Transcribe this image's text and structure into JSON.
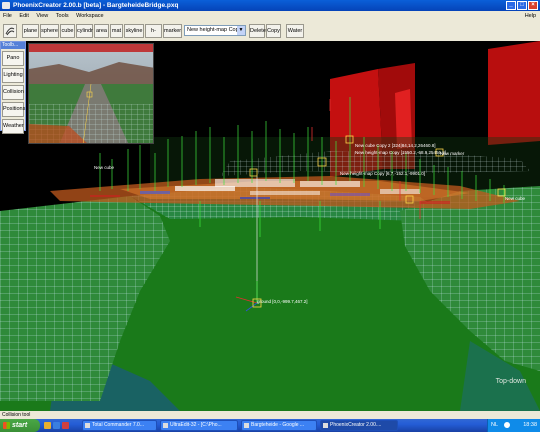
{
  "window": {
    "title": "PhoenixCreator 2.00.b [beta] - BargteheideBridge.pxq",
    "buttons": [
      "_",
      "□",
      "×"
    ]
  },
  "menu": {
    "items": [
      "File",
      "Edit",
      "View",
      "Tools",
      "Workspace"
    ],
    "help": "Help"
  },
  "toolbar": {
    "buttons": [
      "plane",
      "sphere",
      "cube",
      "cylindr",
      "area",
      "mat",
      "skyline",
      "h-map",
      "marker"
    ],
    "select_value": "New height-map Copy",
    "actions": [
      "Delete",
      "Copy",
      "Water"
    ]
  },
  "toolpanel": {
    "title": "Toolb...",
    "items": [
      "Pano",
      "Lighting",
      "Collision",
      "Positions",
      "Weather"
    ]
  },
  "viewport": {
    "labels": {
      "cube_copy2": "New cube Copy 2 [324|84,14,2,26460.8]",
      "heightmap_copy": "New height-map Copy [1550.2,-68.9,25456.8]",
      "new_marker": "New marker",
      "heightmap_copy2": "New height-map Copy [6,7,-152.1,-9901.0]",
      "sun": "Sun [-140.5,428.9,-78.9]",
      "new_cube": "New cube",
      "new_cube_right": "New cube",
      "ground": "ground [0,0,-999.7,467.2]"
    },
    "mode_label": "Top-down"
  },
  "status": {
    "text": "Collision tool"
  },
  "taskbar": {
    "start": "start",
    "tasks": [
      "Total Commander 7.0...",
      "UltraEdit-32 - [C:\\Pho...",
      "Bargteheide - Google ...",
      "PhoenixCreator 2.00...."
    ],
    "tray_lang": "NL",
    "clock": "18:38"
  },
  "colors": {
    "accent": "#0a5fd8",
    "ground": "#1a7a1a",
    "wire": "#bfe3e8",
    "marker": "#ffd84a"
  }
}
